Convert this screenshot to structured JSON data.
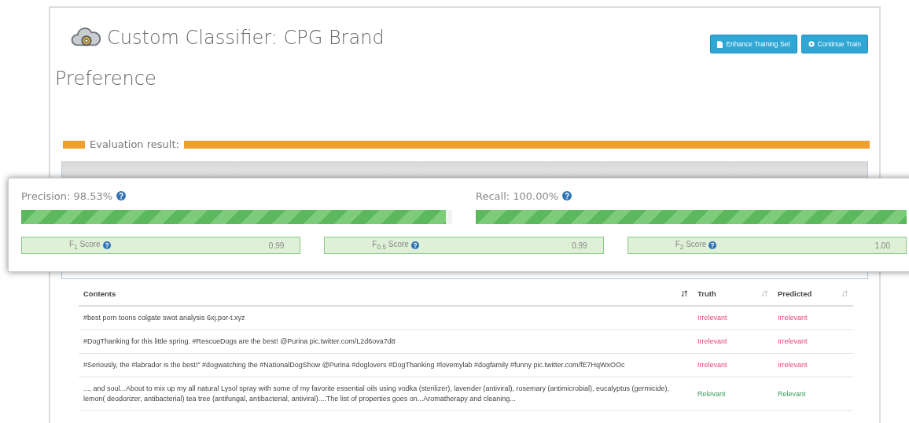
{
  "header": {
    "title": "Custom Classifier: CPG Brand",
    "title_continued": "Preference",
    "buttons": [
      {
        "label": "Enhance Training Set",
        "kind": "file"
      },
      {
        "label": "Continue Train",
        "kind": "gear"
      }
    ]
  },
  "evaluation": {
    "title": "Evaluation result:",
    "precision": {
      "label": "Precision: 98.53%",
      "level": 0.9853
    },
    "recall": {
      "label": "Recall: 100.00%",
      "level": 1.0
    },
    "scores": [
      {
        "label": "F$_{1}$ Score",
        "value": "0.99"
      },
      {
        "label": "F$_{0.5}$ Score",
        "value": "0.99"
      },
      {
        "label": "F$_{2}$ Score",
        "value": "1.00"
      }
    ]
  },
  "table": {
    "columns": [
      {
        "label": "Contents",
        "sorted": true
      },
      {
        "label": "Truth",
        "sorted": false
      },
      {
        "label": "Predicted",
        "sorted": false
      }
    ],
    "rows": [
      {
        "content": "#best porn toons colgate swot analysis 6xj.por-t.xyz",
        "truth": {
          "label": "Irrelevant",
          "kind": "irrelevant"
        },
        "predicted": {
          "label": "Irrelevant",
          "kind": "irrelevant"
        }
      },
      {
        "content": "#DogThanking for this little spring. #RescueDogs are the best! @Purina pic.twitter.com/L2d6ova7d8",
        "truth": {
          "label": "Irrelevant",
          "kind": "irrelevant"
        },
        "predicted": {
          "label": "Irrelevant",
          "kind": "irrelevant"
        }
      },
      {
        "content": "#Seriously, the #labrador is the best!\" #dogwatching the #NationalDogShow @Purina #doglovers #DogThanking #lovemylab #dogfamily #funny pic.twitter.com/fE7HqWxOOc",
        "truth": {
          "label": "Irrelevant",
          "kind": "irrelevant"
        },
        "predicted": {
          "label": "Irrelevant",
          "kind": "irrelevant"
        }
      },
      {
        "content": "..., and soul...About to mix up my all natural Lysol spray with some of my favorite essential oils using vodka (sterilizer), lavender (antiviral), rosemary (antimicrobial), eucalyptus (germicide), lemon( deodorizer, antibacterial) tea tree (antifungal, antibacterial, antiviral)....The list of properties goes on...Aromatherapy and cleaning...",
        "truth": {
          "label": "Relevant",
          "kind": "relevant"
        },
        "predicted": {
          "label": "Relevant",
          "kind": "relevant"
        }
      }
    ]
  }
}
